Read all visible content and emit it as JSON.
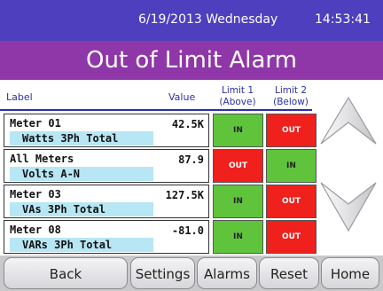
{
  "header": {
    "date": "6/19/2013  Wednesday",
    "time": "14:53:41"
  },
  "title": "Out of Limit Alarm",
  "table": {
    "columns": {
      "label": "Label",
      "value": "Value",
      "limit1": [
        "Limit 1",
        "(Above)"
      ],
      "limit2": [
        "Limit 2",
        "(Below)"
      ]
    },
    "rows": [
      {
        "meter": "Meter 01",
        "quantity": "Watts 3Ph Total",
        "value": "42.5K",
        "limit1": "IN",
        "limit2": "OUT"
      },
      {
        "meter": "All Meters",
        "quantity": "Volts A-N",
        "value": "87.9",
        "limit1": "OUT",
        "limit2": "IN"
      },
      {
        "meter": "Meter 03",
        "quantity": "VAs 3Ph Total",
        "value": "127.5K",
        "limit1": "IN",
        "limit2": "OUT"
      },
      {
        "meter": "Meter 08",
        "quantity": "VARs 3Ph Total",
        "value": "-81.0",
        "limit1": "IN",
        "limit2": "OUT"
      }
    ]
  },
  "scroll": {
    "up_icon": "chevron-up-icon",
    "down_icon": "chevron-down-icon"
  },
  "buttons": {
    "back": "Back",
    "settings": "Settings",
    "alarms": "Alarms",
    "reset": "Reset",
    "home": "Home"
  },
  "colors": {
    "header": "#4d3fbd",
    "title": "#8f37a8",
    "in": "#5fc43c",
    "out": "#f0201c",
    "highlight": "#b7e6f4"
  }
}
